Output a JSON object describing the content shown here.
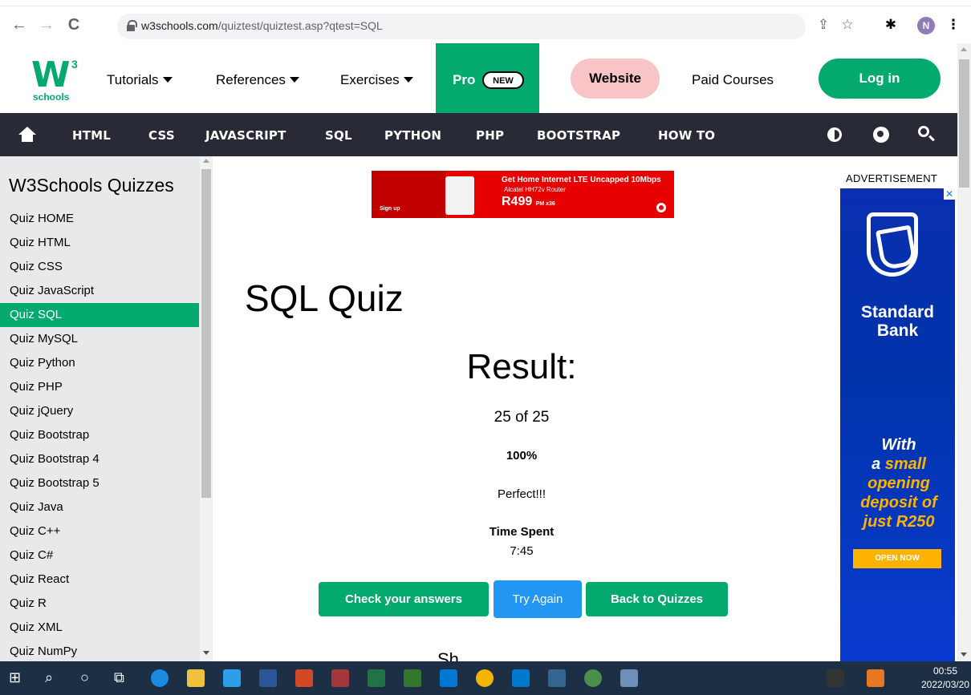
{
  "browser": {
    "url_host": "w3schools.com",
    "url_path": "/quiztest/quiztest.asp?qtest=SQL",
    "profile_initial": "N"
  },
  "topnav": {
    "logo_super": "3",
    "logo_text": "schools",
    "tutorials": "Tutorials",
    "references": "References",
    "exercises": "Exercises",
    "pro": "Pro",
    "new_badge": "NEW",
    "website": "Website",
    "paid_courses": "Paid Courses",
    "login": "Log in"
  },
  "subnav": {
    "items": [
      "HTML",
      "CSS",
      "JAVASCRIPT",
      "SQL",
      "PYTHON",
      "PHP",
      "BOOTSTRAP",
      "HOW TO"
    ]
  },
  "sidebar": {
    "title": "W3Schools Quizzes",
    "items": [
      "Quiz HOME",
      "Quiz HTML",
      "Quiz CSS",
      "Quiz JavaScript",
      "Quiz SQL",
      "Quiz MySQL",
      "Quiz Python",
      "Quiz PHP",
      "Quiz jQuery",
      "Quiz Bootstrap",
      "Quiz Bootstrap 4",
      "Quiz Bootstrap 5",
      "Quiz Java",
      "Quiz C++",
      "Quiz C#",
      "Quiz React",
      "Quiz R",
      "Quiz XML",
      "Quiz NumPy"
    ],
    "active_index": 4
  },
  "ad_banner": {
    "line1": "Get Home Internet LTE Uncapped 10Mbps",
    "line2": "Alcatel HH72v Router",
    "price": "R499",
    "price_suffix": "PM x36",
    "signup": "Sign up"
  },
  "quiz": {
    "title": "SQL Quiz",
    "result_heading": "Result:",
    "score": "25 of 25",
    "percent": "100%",
    "verdict": "Perfect!!!",
    "time_label": "Time Spent",
    "time_value": "7:45",
    "check_answers": "Check your answers",
    "try_again": "Try Again",
    "back_to_quizzes": "Back to Quizzes",
    "partial_text": "Sh"
  },
  "right_ad": {
    "label": "ADVERTISEMENT",
    "close": "✕",
    "bank_name_1": "Standard",
    "bank_name_2": "Bank",
    "slogan_1": "With",
    "slogan_2a": "a ",
    "slogan_2b": "small",
    "slogan_3": "opening",
    "slogan_4": "deposit of",
    "slogan_5": "just R250",
    "cta": "OPEN NOW"
  },
  "taskbar": {
    "time": "00:55",
    "date": "2022/03/20"
  },
  "colors": {
    "w3_green": "#04aa6d",
    "subnav_dark": "#282a35",
    "sidebar_bg": "#e7e9eb",
    "website_pink": "#f8c4c6",
    "try_again_blue": "#2196f3",
    "taskbar": "#1c2f44"
  }
}
